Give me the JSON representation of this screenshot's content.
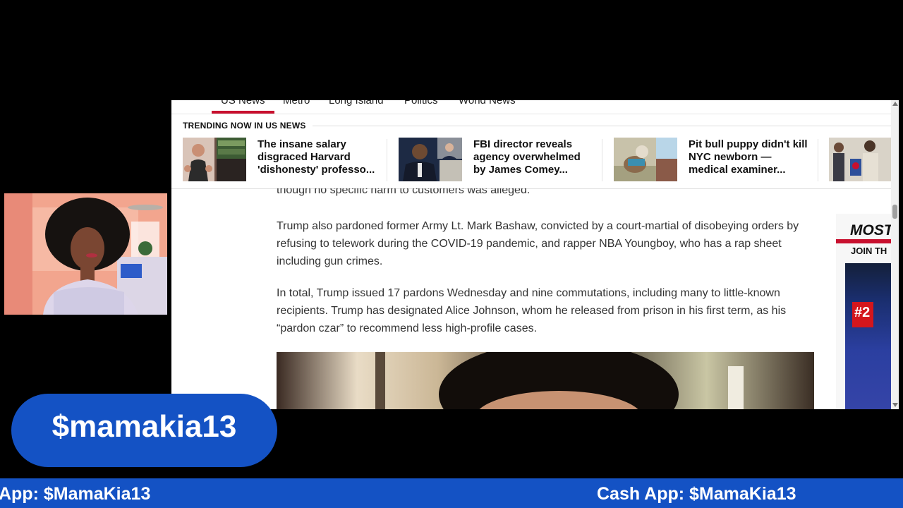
{
  "browser": {
    "nav": {
      "items": [
        "US News",
        "Metro",
        "Long Island",
        "Politics",
        "World News"
      ],
      "active": "US News"
    },
    "trending": {
      "title": "TRENDING NOW IN US NEWS",
      "items": [
        {
          "headline": "The insane salary disgraced Harvard 'dishonesty' professo..."
        },
        {
          "headline": "FBI director reveals agency overwhelmed by James Comey..."
        },
        {
          "headline": "Pit bull puppy didn't kill NYC newborn — medical examiner..."
        }
      ]
    },
    "article": {
      "clipped_line": "though no specific harm to customers was alleged.",
      "paragraphs": [
        "Trump also pardoned former Army Lt. Mark Bashaw, convicted by a court-martial of disobeying orders by refusing to telework during the COVID-19  pandemic, and rapper NBA Youngboy, who has a rap sheet including gun crimes.",
        "In total, Trump issued 17 pardons Wednesday and nine commutations, including many to little-known recipients. Trump has designated Alice Johnson, whom he released from prison in his first term, as his “pardon czar” to recommend less high-profile cases."
      ]
    },
    "side_ad": {
      "headline": "MOST",
      "sub": "JOIN TH",
      "badge": "#2"
    }
  },
  "overlay": {
    "handle": "$mamakia13",
    "ticker": [
      "App: $MamaKia13",
      "Cash App: $MamaKia13"
    ]
  },
  "colors": {
    "accent_blue": "#1452c4",
    "news_red": "#c8102e"
  }
}
